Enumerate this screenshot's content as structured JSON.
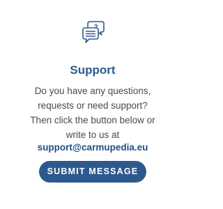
{
  "support": {
    "icon": "chat-question-icon",
    "icon_glyph": "?",
    "title": "Support",
    "lines": [
      "Do you have any questions,",
      "requests or need support?",
      "Then click the button below or",
      "write to us at"
    ],
    "email": "support@carmupedia.eu",
    "button_label": "SUBMIT MESSAGE"
  },
  "colors": {
    "accent": "#2d5a8e",
    "email": "#1f4f86",
    "body_text": "#4a4a4a",
    "background": "#ffffff"
  }
}
